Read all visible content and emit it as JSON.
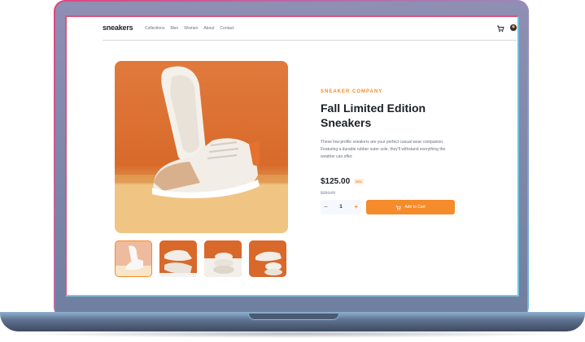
{
  "nav": {
    "logo": "sneakers",
    "links": [
      "Collections",
      "Men",
      "Women",
      "About",
      "Contact"
    ]
  },
  "product": {
    "company": "SNEAKER COMPANY",
    "title": "Fall Limited Edition Sneakers",
    "description": "These low-profile sneakers are your perfect casual wear companion. Featuring a durable rubber outer sole, they'll withstand everything the weather can offer.",
    "price": "$125.00",
    "discount": "50%",
    "old_price": "$250.00",
    "quantity": "1",
    "add_to_cart": "Add to Cart"
  },
  "colors": {
    "accent": "#f58b2a",
    "text_dark": "#1d2026",
    "text_muted": "#69707d",
    "image_background": "#d9682b"
  },
  "icons": [
    "cart-icon",
    "minus-icon",
    "plus-icon"
  ]
}
